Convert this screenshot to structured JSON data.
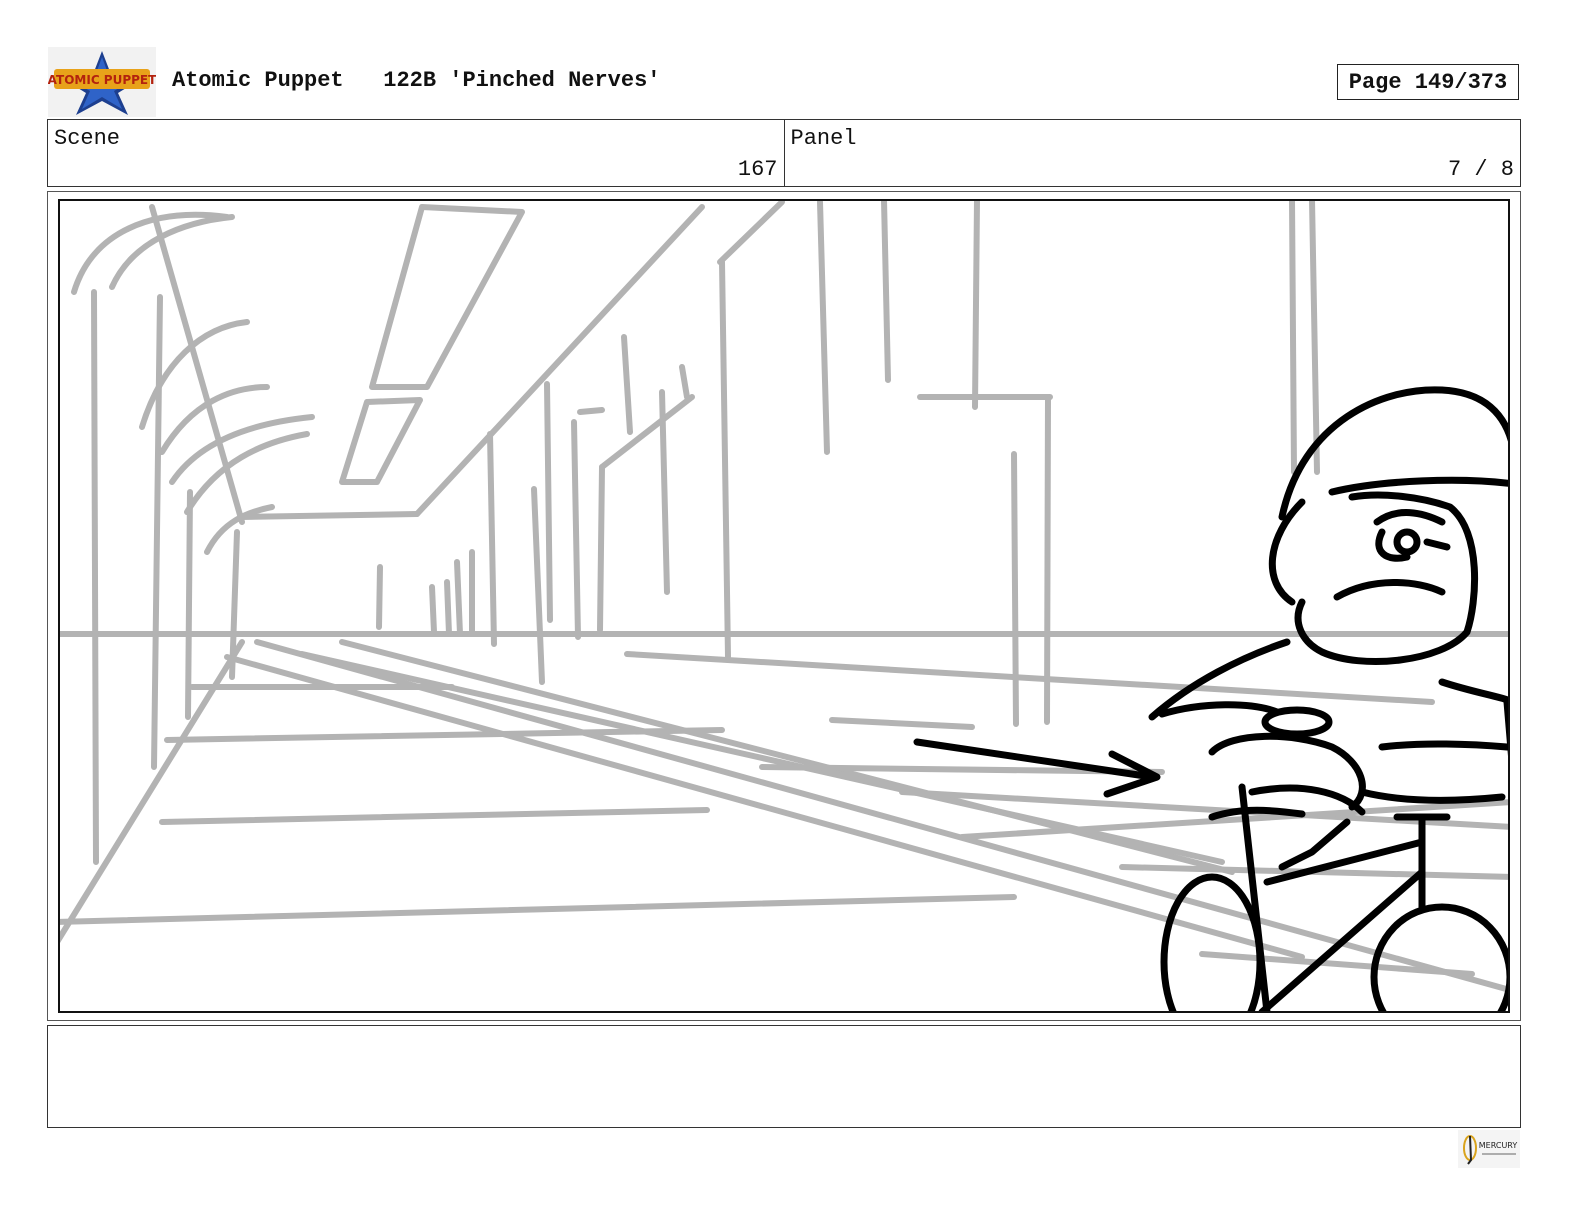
{
  "header": {
    "logo_icon": "atomic-puppet-logo",
    "logo_text": "ATOMIC PUPPET",
    "show_title": "Atomic Puppet",
    "episode": "122B 'Pinched Nerves'",
    "page": "Page 149/373"
  },
  "info": {
    "scene_label": "Scene",
    "scene_value": "167",
    "panel_label": "Panel",
    "panel_value": "7 / 8"
  },
  "panel": {
    "image_icon": "storyboard-sketch-image",
    "description_notes": ""
  },
  "footer": {
    "logo_icon": "mercury-filmworks-logo",
    "logo_text": "MERCURY"
  },
  "colors": {
    "sketch_rough": "#b3b3b3",
    "sketch_ink": "#000000",
    "border": "#333333"
  }
}
